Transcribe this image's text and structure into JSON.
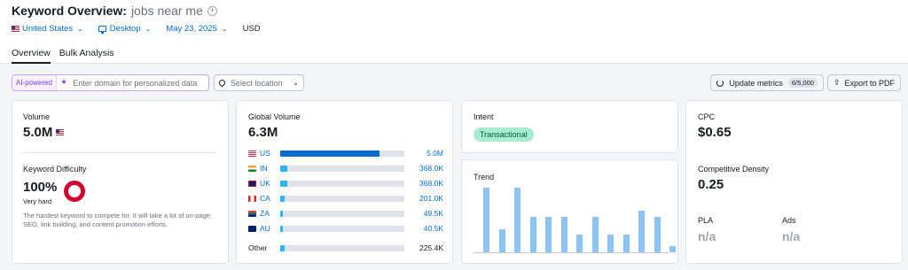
{
  "header": {
    "title": "Keyword Overview:",
    "keyword": "jobs near me",
    "add_symbol": "+"
  },
  "filters": {
    "country": "United States",
    "device": "Desktop",
    "date": "May 23, 2025",
    "currency": "USD"
  },
  "tabs": [
    {
      "label": "Overview",
      "active": true
    },
    {
      "label": "Bulk Analysis",
      "active": false
    }
  ],
  "toolbar": {
    "ai_label": "AI-powered",
    "domain_placeholder": "Enter domain for personalized data",
    "location_placeholder": "Select location",
    "update_label": "Update metrics",
    "update_count": "6/5,000",
    "export_label": "Export to PDF"
  },
  "volume": {
    "label": "Volume",
    "value": "5.0M"
  },
  "difficulty": {
    "label": "Keyword Difficulty",
    "value": "100%",
    "level": "Very hard",
    "description": "The hardest keyword to compete for. It will take a lot of on-page SEO, link building, and content promotion efforts.",
    "color": "#d1002f"
  },
  "global_volume": {
    "label": "Global Volume",
    "value": "6.3M",
    "rows": [
      {
        "code": "US",
        "value": "5.0M",
        "share": 0.8,
        "color": "#006dca"
      },
      {
        "code": "IN",
        "value": "368.0K",
        "share": 0.06,
        "color": "#2bb3ff"
      },
      {
        "code": "UK",
        "value": "368.0K",
        "share": 0.06,
        "color": "#2bb3ff"
      },
      {
        "code": "CA",
        "value": "201.0K",
        "share": 0.035,
        "color": "#2bb3ff"
      },
      {
        "code": "ZA",
        "value": "49.5K",
        "share": 0.02,
        "color": "#2bb3ff"
      },
      {
        "code": "AU",
        "value": "40.5K",
        "share": 0.02,
        "color": "#2bb3ff"
      }
    ],
    "other": {
      "label": "Other",
      "value": "225.4K",
      "share": 0.035
    }
  },
  "intent": {
    "label": "Intent",
    "badge": "Transactional",
    "badge_color": "#a9ecd4"
  },
  "trend": {
    "label": "Trend",
    "values": [
      1.0,
      0.35,
      1.0,
      0.55,
      0.55,
      0.55,
      0.27,
      0.55,
      0.27,
      0.27,
      0.65,
      0.55,
      0.1
    ],
    "color": "#8cc4f5"
  },
  "cpc": {
    "label": "CPC",
    "value": "$0.65"
  },
  "competitive_density": {
    "label": "Competitive Density",
    "value": "0.25"
  },
  "pla": {
    "label": "PLA",
    "value": "n/a"
  },
  "ads": {
    "label": "Ads",
    "value": "n/a"
  }
}
